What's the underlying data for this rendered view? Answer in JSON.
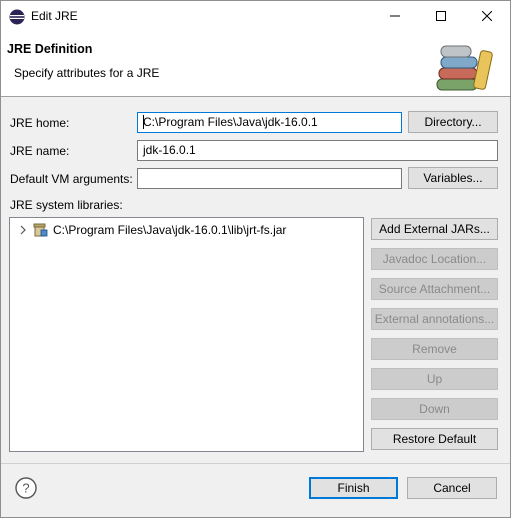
{
  "window": {
    "title": "Edit JRE",
    "minimize_glyph": "—",
    "close_glyph": "✕"
  },
  "banner": {
    "title": "JRE Definition",
    "subtitle": "Specify attributes for a JRE",
    "icon": "library-books-icon"
  },
  "form": {
    "jre_home_label": "JRE home:",
    "jre_home_value": "C:\\Program Files\\Java\\jdk-16.0.1",
    "directory_button": "Directory...",
    "jre_name_label": "JRE name:",
    "jre_name_value": "jdk-16.0.1",
    "vm_args_label": "Default VM arguments:",
    "vm_args_value": "",
    "variables_button": "Variables...",
    "libraries_label": "JRE system libraries:"
  },
  "libraries": [
    {
      "path": "C:\\Program Files\\Java\\jdk-16.0.1\\lib\\jrt-fs.jar"
    }
  ],
  "side_buttons": [
    {
      "label": "Add External JARs...",
      "enabled": true
    },
    {
      "label": "Javadoc Location...",
      "enabled": false
    },
    {
      "label": "Source Attachment...",
      "enabled": false
    },
    {
      "label": "External annotations...",
      "enabled": false
    },
    {
      "label": "Remove",
      "enabled": false
    },
    {
      "label": "Up",
      "enabled": false
    },
    {
      "label": "Down",
      "enabled": false
    },
    {
      "label": "Restore Default",
      "enabled": true
    }
  ],
  "footer": {
    "help_glyph": "?",
    "finish_button": "Finish",
    "cancel_button": "Cancel"
  },
  "colors": {
    "accent": "#0078d7",
    "button_bg": "#e1e1e1",
    "disabled_bg": "#cccccc"
  }
}
